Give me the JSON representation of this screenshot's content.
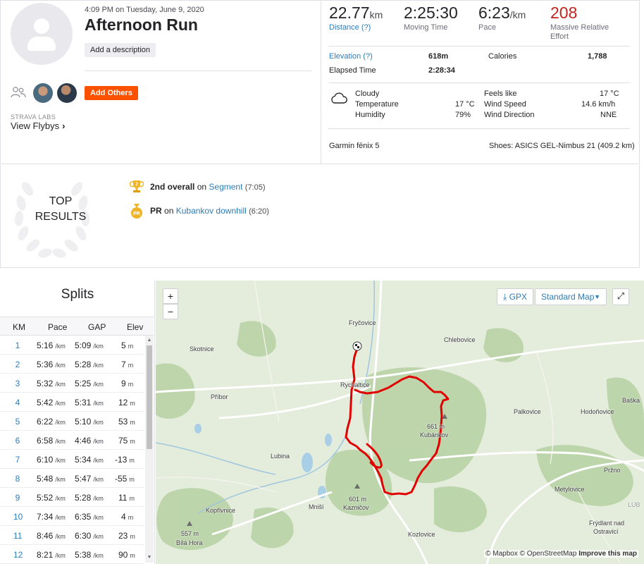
{
  "activity": {
    "date": "4:09 PM on Tuesday, June 9, 2020",
    "title": "Afternoon Run",
    "add_description": "Add a description",
    "add_others": "Add Others",
    "labs": "STRAVA LABS",
    "flybys": "View Flybys"
  },
  "stats": {
    "distance_value": "22.77",
    "distance_unit": "km",
    "distance_label": "Distance (?)",
    "moving_time_value": "2:25:30",
    "moving_time_label": "Moving Time",
    "pace_value": "6:23",
    "pace_unit": "/km",
    "pace_label": "Pace",
    "relative_effort_value": "208",
    "relative_effort_label_1": "Massive Relative",
    "relative_effort_label_2": "Effort",
    "elevation_label": "Elevation (?)",
    "elevation_value": "618m",
    "calories_label": "Calories",
    "calories_value": "1,788",
    "elapsed_label": "Elapsed Time",
    "elapsed_value": "2:28:34"
  },
  "weather": {
    "condition": "Cloudy",
    "temperature_label": "Temperature",
    "temperature_value": "17 °C",
    "humidity_label": "Humidity",
    "humidity_value": "79%",
    "feels_like_label": "Feels like",
    "feels_like_value": "17 °C",
    "wind_speed_label": "Wind Speed",
    "wind_speed_value": "14.6 km/h",
    "wind_direction_label": "Wind Direction",
    "wind_direction_value": "NNE"
  },
  "gear": {
    "device": "Garmin fēnix 5",
    "shoes": "Shoes: ASICS GEL-Nimbus 21 (409.2 km)"
  },
  "results": {
    "heading_1": "TOP",
    "heading_2": "RESULTS",
    "achievements": [
      {
        "rank": "2nd overall",
        "on": "on",
        "segment": "Segment",
        "time": "(7:05)"
      },
      {
        "rank": "PR",
        "on": "on",
        "segment": "Kubankov downhill",
        "time": "(6:20)"
      }
    ],
    "pr_badge": "PR"
  },
  "splits": {
    "title": "Splits",
    "headers": {
      "km": "KM",
      "pace": "Pace",
      "gap": "GAP",
      "elev": "Elev"
    },
    "unit": "/km",
    "elev_unit": "m",
    "rows": [
      {
        "km": "1",
        "pace": "5:16",
        "gap": "5:09",
        "elev": "5"
      },
      {
        "km": "2",
        "pace": "5:36",
        "gap": "5:28",
        "elev": "7"
      },
      {
        "km": "3",
        "pace": "5:32",
        "gap": "5:25",
        "elev": "9"
      },
      {
        "km": "4",
        "pace": "5:42",
        "gap": "5:31",
        "elev": "12"
      },
      {
        "km": "5",
        "pace": "6:22",
        "gap": "5:10",
        "elev": "53"
      },
      {
        "km": "6",
        "pace": "6:58",
        "gap": "4:46",
        "elev": "75"
      },
      {
        "km": "7",
        "pace": "6:10",
        "gap": "5:34",
        "elev": "-13"
      },
      {
        "km": "8",
        "pace": "5:48",
        "gap": "5:47",
        "elev": "-55"
      },
      {
        "km": "9",
        "pace": "5:52",
        "gap": "5:28",
        "elev": "11"
      },
      {
        "km": "10",
        "pace": "7:34",
        "gap": "6:35",
        "elev": "4"
      },
      {
        "km": "11",
        "pace": "8:46",
        "gap": "6:30",
        "elev": "23"
      },
      {
        "km": "12",
        "pace": "8:21",
        "gap": "5:38",
        "elev": "90"
      }
    ]
  },
  "map": {
    "zoom_in": "+",
    "zoom_out": "−",
    "gpx": "GPX",
    "map_type": "Standard Map",
    "places": {
      "frycovice": "Fryčovice",
      "chlebovice": "Chlebovice",
      "skotnice": "Skotnice",
      "rychaltice": "Rychaltice",
      "pribor": "Příbor",
      "baska": "Baška",
      "palkovice": "Palkovice",
      "hodonovice": "Hodoňovice",
      "peak_kubankov_alt": "661 m",
      "peak_kubankov": "Kubánkov",
      "lubina": "Lubina",
      "przno": "Pržno",
      "metylovice": "Metylovice",
      "kopřivnice": "Kopřivnice",
      "mnisi": "Mniší",
      "peak_kaznicov_alt": "601 m",
      "peak_kaznicov": "Kazničov",
      "lub": "LUB",
      "peak_bila_alt": "557 m",
      "peak_bila": "Bílá Hora",
      "kozlovice": "Kozlovice",
      "frydlant_1": "Frýdlant nad",
      "frydlant_2": "Ostravicí"
    },
    "attribution_mapbox": "© Mapbox",
    "attribution_osm": "© OpenStreetMap",
    "attribution_improve": "Improve this map"
  },
  "colors": {
    "brand": "#fc5200",
    "link": "#2d7cb8",
    "relative_effort": "#c0261f",
    "route": "#e00000"
  }
}
